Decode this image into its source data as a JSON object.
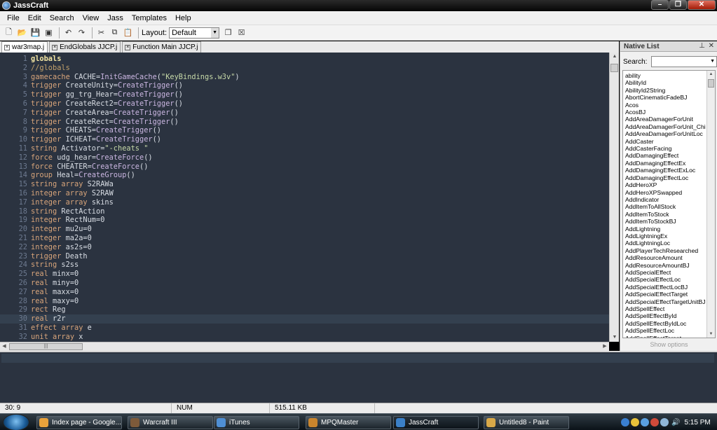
{
  "window": {
    "title": "JassCraft"
  },
  "menu": [
    "File",
    "Edit",
    "Search",
    "View",
    "Jass",
    "Templates",
    "Help"
  ],
  "toolbar": {
    "layout_label": "Layout:",
    "layout_value": "Default"
  },
  "tabs": [
    {
      "label": "war3map.j",
      "active": true
    },
    {
      "label": "EndGlobals JJCP.j",
      "active": false
    },
    {
      "label": "Function Main JJCP.j",
      "active": false
    }
  ],
  "editor": {
    "current_line": 30,
    "lines": [
      {
        "n": "1",
        "t": "globals"
      },
      {
        "n": "2",
        "t": "//globals"
      },
      {
        "n": "3",
        "t": "gamecache CACHE=InitGameCache(\"KeyBindings.w3v\")"
      },
      {
        "n": "4",
        "t": "trigger CreateUnity=CreateTrigger()"
      },
      {
        "n": "5",
        "t": "trigger gg_trg_Hear=CreateTrigger()"
      },
      {
        "n": "6",
        "t": "trigger CreateRect2=CreateTrigger()"
      },
      {
        "n": "7",
        "t": "trigger CreateArea=CreateTrigger()"
      },
      {
        "n": "8",
        "t": "trigger CreateRect=CreateTrigger()"
      },
      {
        "n": "9",
        "t": "trigger CHEATS=CreateTrigger()"
      },
      {
        "n": "10",
        "t": "trigger ICHEAT=CreateTrigger()"
      },
      {
        "n": "11",
        "t": "string Activator=\"-cheats \""
      },
      {
        "n": "12",
        "t": "force udg_hear=CreateForce()"
      },
      {
        "n": "13",
        "t": "force CHEATER=CreateForce()"
      },
      {
        "n": "14",
        "t": "group Heal=CreateGroup()"
      },
      {
        "n": "15",
        "t": "string array S2RAWa"
      },
      {
        "n": "16",
        "t": "integer array S2RAW"
      },
      {
        "n": "17",
        "t": "integer array skins"
      },
      {
        "n": "18",
        "t": "string RectAction"
      },
      {
        "n": "19",
        "t": "integer RectNum=0"
      },
      {
        "n": "20",
        "t": "integer mu2u=0"
      },
      {
        "n": "21",
        "t": "integer ma2a=0"
      },
      {
        "n": "22",
        "t": "integer as2s=0"
      },
      {
        "n": "23",
        "t": "trigger Death"
      },
      {
        "n": "24",
        "t": "string s2ss"
      },
      {
        "n": "25",
        "t": "real minx=0"
      },
      {
        "n": "26",
        "t": "real miny=0"
      },
      {
        "n": "27",
        "t": "real maxx=0"
      },
      {
        "n": "28",
        "t": "real maxy=0"
      },
      {
        "n": "29",
        "t": "rect Reg"
      },
      {
        "n": "30",
        "t": "real r2r"
      },
      {
        "n": "31",
        "t": "effect array e"
      },
      {
        "n": "32",
        "t": "unit array x"
      }
    ]
  },
  "native_list": {
    "title": "Native List",
    "search_label": "Search:",
    "search_value": "",
    "show_options": "Show options",
    "items": [
      "ability",
      "AbilityId",
      "AbilityId2String",
      "AbortCinematicFadeBJ",
      "Acos",
      "AcosBJ",
      "AddAreaDamagerForUnit",
      "AddAreaDamagerForUnit_Chi",
      "AddAreaDamagerForUnitLoc",
      "AddCaster",
      "AddCasterFacing",
      "AddDamagingEffect",
      "AddDamagingEffectEx",
      "AddDamagingEffectExLoc",
      "AddDamagingEffectLoc",
      "AddHeroXP",
      "AddHeroXPSwapped",
      "AddIndicator",
      "AddItemToAllStock",
      "AddItemToStock",
      "AddItemToStockBJ",
      "AddLightning",
      "AddLightningEx",
      "AddLightningLoc",
      "AddPlayerTechResearched",
      "AddResourceAmount",
      "AddResourceAmountBJ",
      "AddSpecialEffect",
      "AddSpecialEffectLoc",
      "AddSpecialEffectLocBJ",
      "AddSpecialEffectTarget",
      "AddSpecialEffectTargetUnitBJ",
      "AddSpellEffect",
      "AddSpellEffectById",
      "AddSpellEffectByIdLoc",
      "AddSpellEffectLoc",
      "AddSpellEffectTarget"
    ]
  },
  "status": {
    "position": "30: 9",
    "num": "NUM",
    "size": "515.11 KB"
  },
  "taskbar": {
    "tasks": [
      {
        "label": "Index page - Google...",
        "color": "#e9a23b"
      },
      {
        "label": "Warcraft III",
        "color": "#7d5a3a"
      },
      {
        "label": "iTunes",
        "color": "#4f8fd4"
      },
      {
        "label": "MPQMaster",
        "color": "#c9852d"
      },
      {
        "label": "JassCraft",
        "color": "#3b80c8"
      },
      {
        "label": "Untitled8 - Paint",
        "color": "#d8a848"
      }
    ],
    "clock": "5:15 PM"
  }
}
